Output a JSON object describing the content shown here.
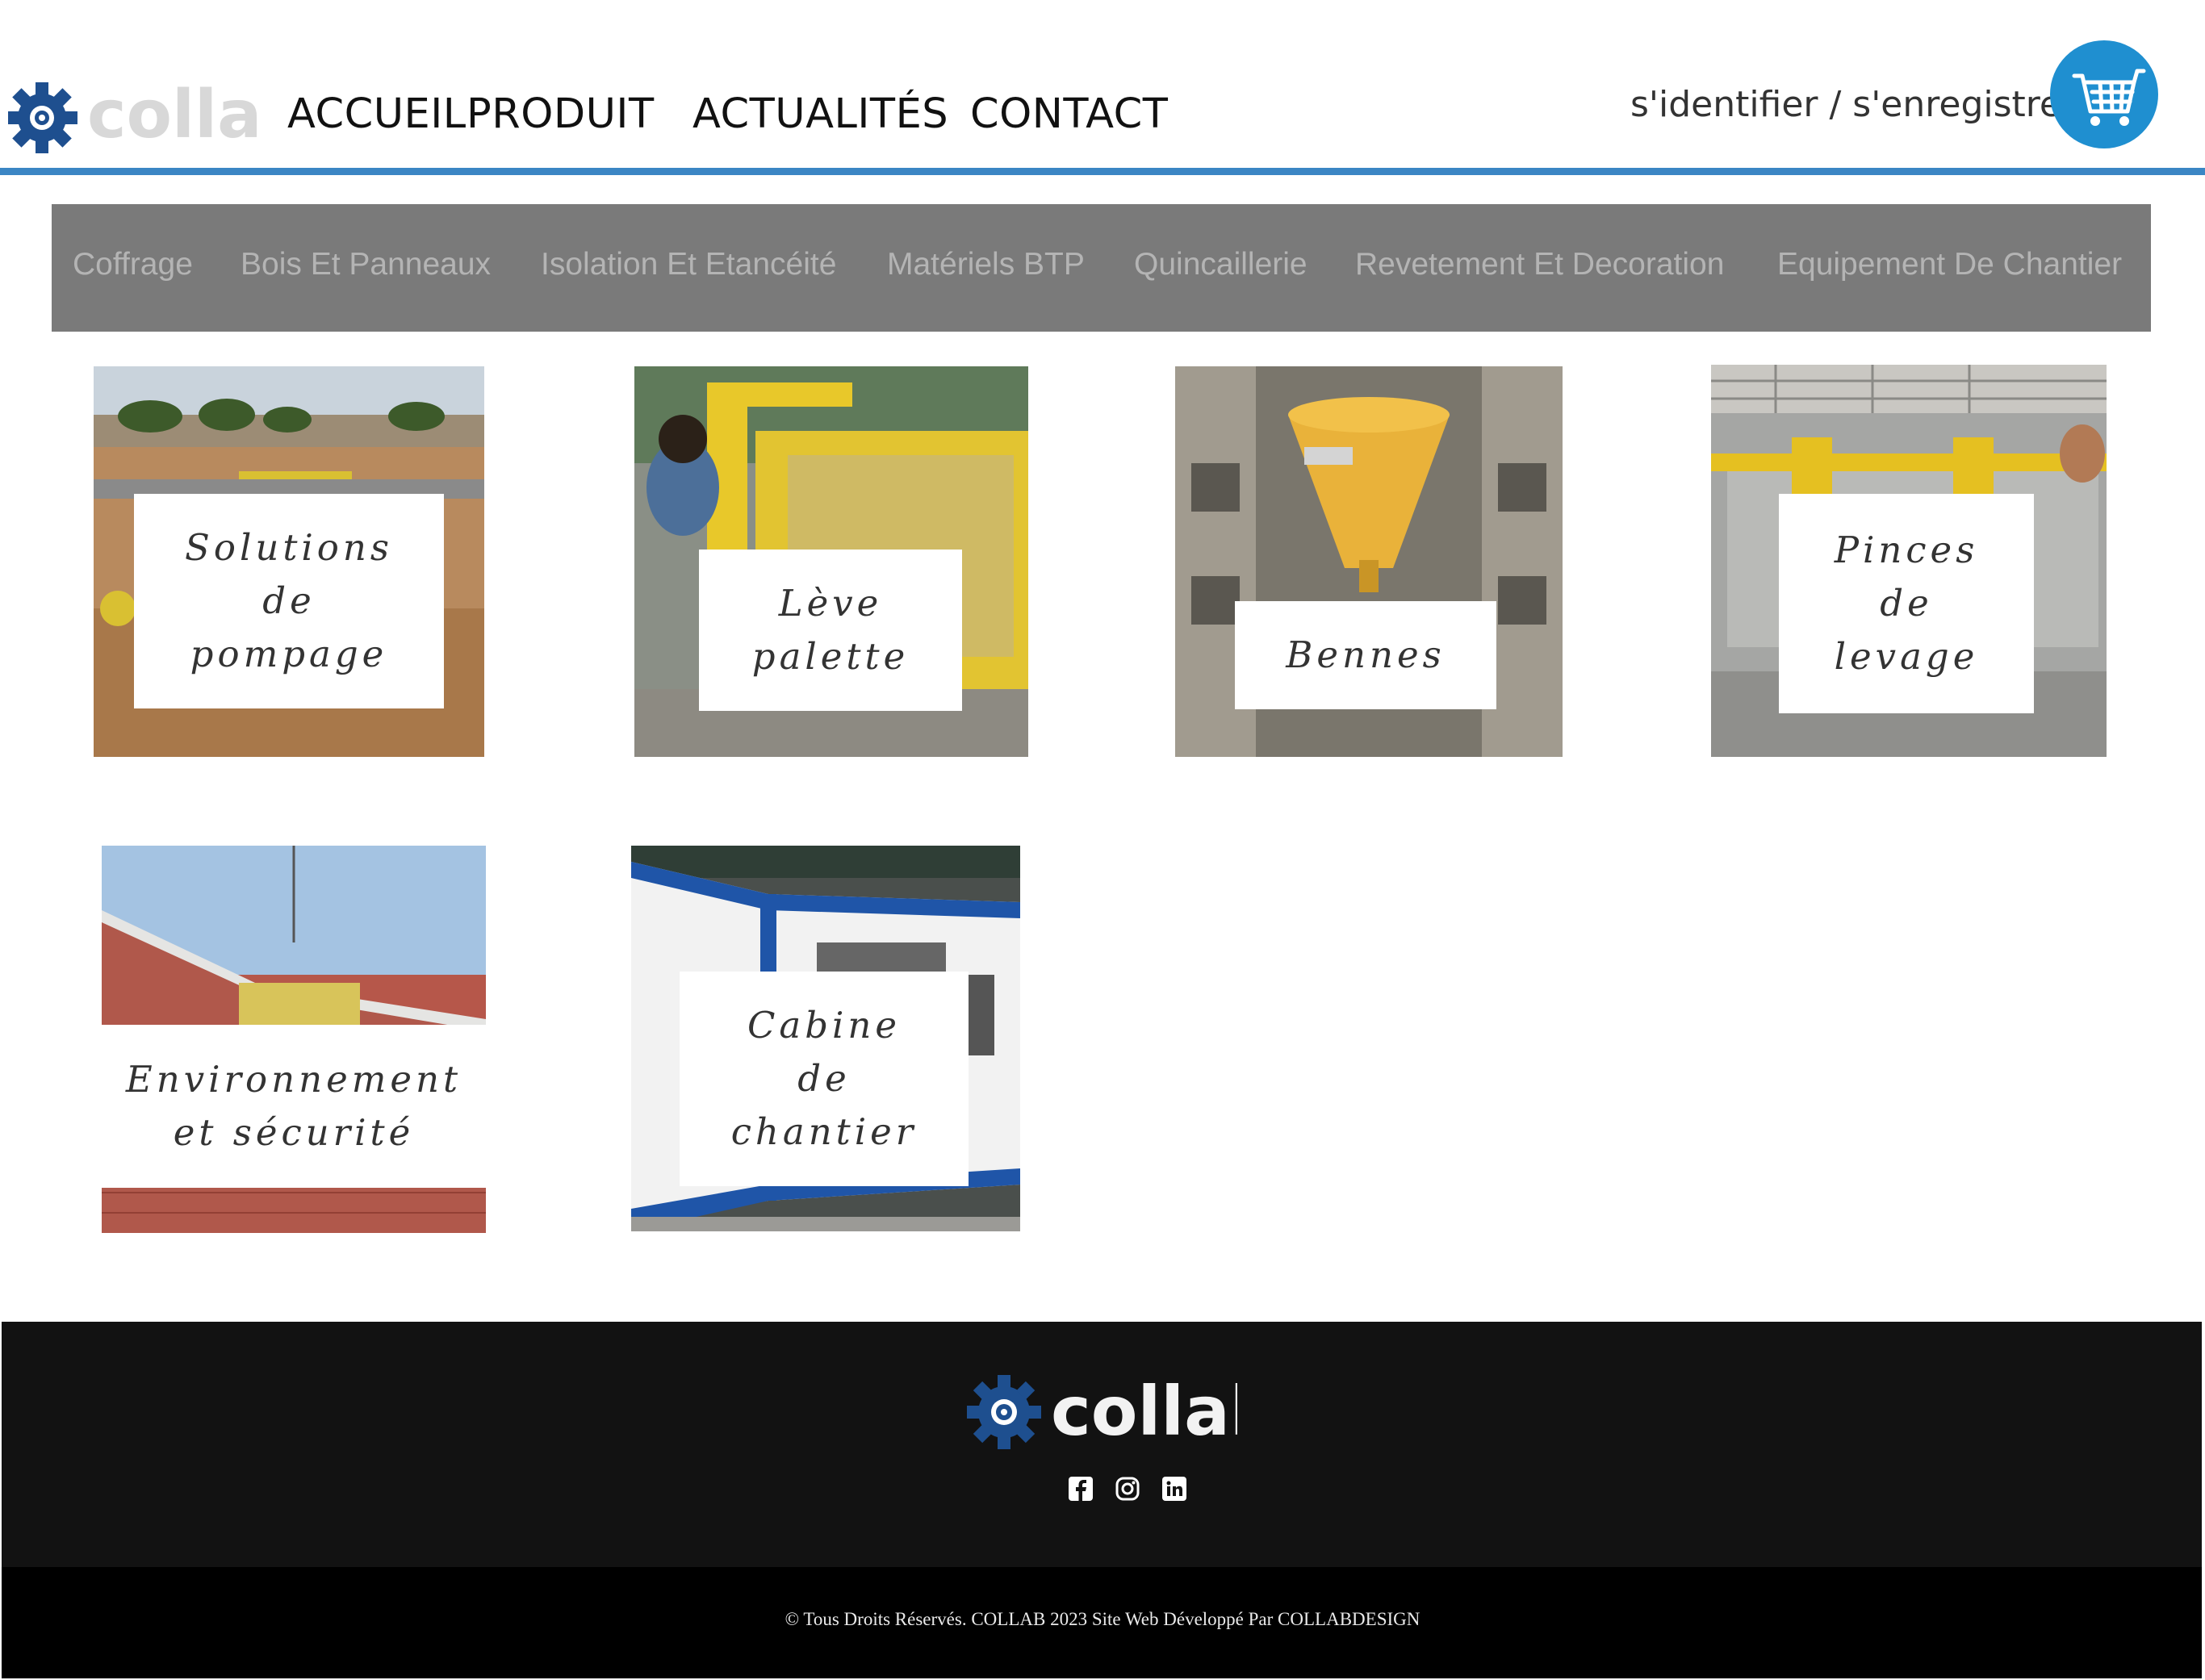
{
  "header": {
    "logo_text": "collab",
    "nav": [
      {
        "label": "ACCUEIL"
      },
      {
        "label": "PRODUIT"
      },
      {
        "label": "ACTUALITÉS"
      },
      {
        "label": "CONTACT"
      }
    ],
    "login_label": "s'identifier / s'enregistrer",
    "cart_icon": "shopping-cart-icon"
  },
  "categories": [
    "Coffrage",
    "Bois Et Panneaux",
    "Isolation Et Etancéité",
    "Matériels BTP",
    "Quincaillerie",
    "Revetement Et Decoration",
    "Equipement De Chantier"
  ],
  "products": [
    {
      "label": "Solutions\nde\npompage"
    },
    {
      "label": "Lève\npalette"
    },
    {
      "label": "Bennes"
    },
    {
      "label": "Pinces\nde\nlevage"
    },
    {
      "label": "Environnement\net sécurité"
    },
    {
      "label": "Cabine\nde\nchantier"
    }
  ],
  "footer": {
    "logo_text": "collab",
    "social": [
      "facebook-icon",
      "instagram-icon",
      "linkedin-icon"
    ],
    "copyright": "© Tous Droits Réservés. COLLAB 2023 Site Web Développé Par COLLABDESIGN"
  },
  "colors": {
    "accent": "#3b86c4",
    "cart": "#1f8fd0",
    "category_bar": "#7a7a7a",
    "footer": "#121212"
  }
}
